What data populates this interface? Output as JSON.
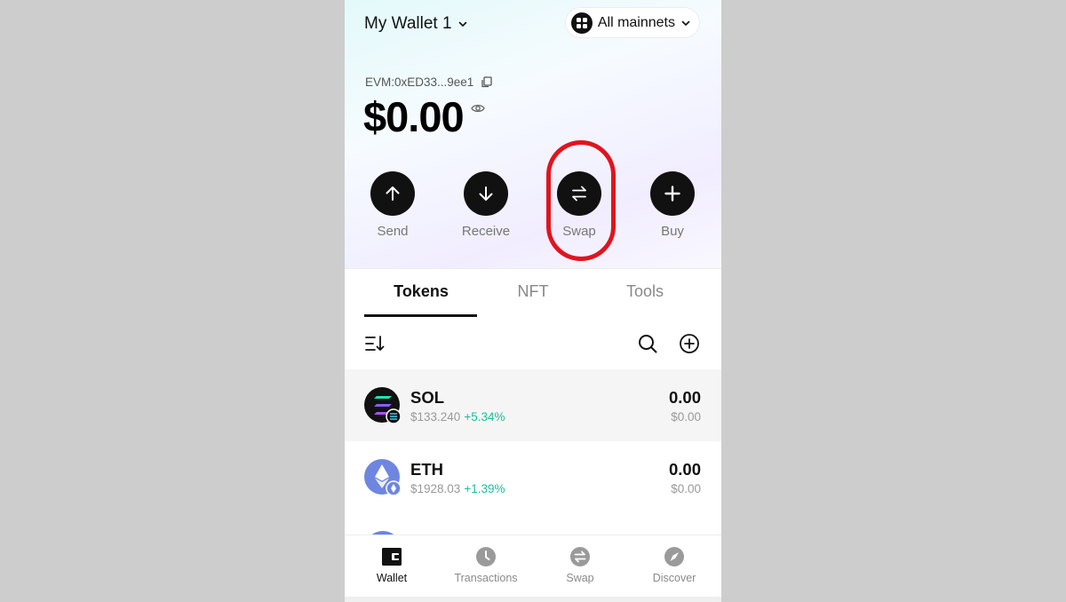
{
  "header": {
    "wallet_name": "My Wallet 1",
    "network_label": "All mainnets"
  },
  "account": {
    "address": "EVM:0xED33...9ee1",
    "balance": "$0.00"
  },
  "actions": [
    {
      "label": "Send"
    },
    {
      "label": "Receive"
    },
    {
      "label": "Swap"
    },
    {
      "label": "Buy"
    }
  ],
  "tabs": [
    {
      "label": "Tokens",
      "active": true
    },
    {
      "label": "NFT",
      "active": false
    },
    {
      "label": "Tools",
      "active": false
    }
  ],
  "tokens": [
    {
      "symbol": "SOL",
      "price": "$133.240",
      "change": "+5.34%",
      "amount": "0.00",
      "value": "$0.00"
    },
    {
      "symbol": "ETH",
      "price": "$1928.03",
      "change": "+1.39%",
      "amount": "0.00",
      "value": "$0.00"
    }
  ],
  "bottom_nav": [
    {
      "label": "Wallet",
      "icon": "wallet-icon",
      "active": true
    },
    {
      "label": "Transactions",
      "icon": "clock-icon",
      "active": false
    },
    {
      "label": "Swap",
      "icon": "swap-icon",
      "active": false
    },
    {
      "label": "Discover",
      "icon": "compass-icon",
      "active": false
    }
  ],
  "colors": {
    "highlight": "#e0141e",
    "positive_change": "#1bbf9b",
    "primary": "#111111"
  }
}
